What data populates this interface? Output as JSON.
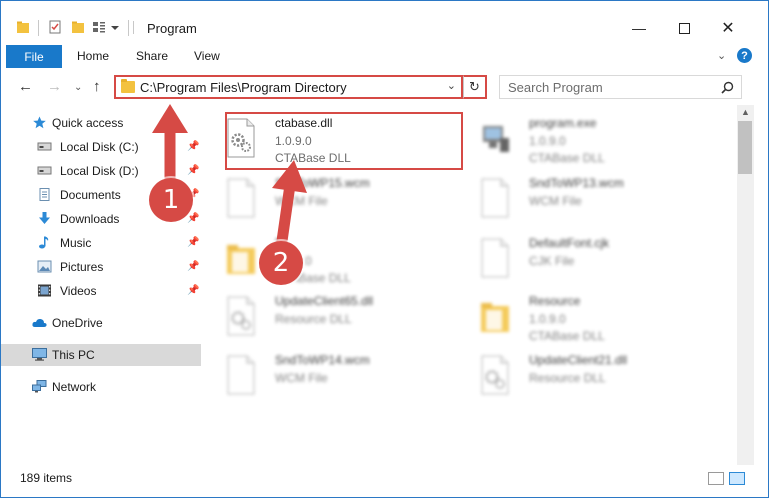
{
  "window": {
    "title": "Program"
  },
  "ribbon": {
    "tabs": [
      "File",
      "Home",
      "Share",
      "View"
    ],
    "help": "?"
  },
  "nav": {
    "back": "←",
    "forward": "→",
    "up": "↑",
    "address": "C:\\Program Files\\Program Directory",
    "refresh": "↻",
    "search_placeholder": "Search Program"
  },
  "sidebar": {
    "items": [
      {
        "label": "Quick access",
        "icon": "star-icon",
        "pinned": false
      },
      {
        "label": "Local Disk (C:)",
        "icon": "drive-icon",
        "pinned": true
      },
      {
        "label": "Local Disk (D:)",
        "icon": "drive-icon",
        "pinned": true
      },
      {
        "label": "Documents",
        "icon": "documents-icon",
        "pinned": true
      },
      {
        "label": "Downloads",
        "icon": "download-icon",
        "pinned": true
      },
      {
        "label": "Music",
        "icon": "music-icon",
        "pinned": true
      },
      {
        "label": "Pictures",
        "icon": "pictures-icon",
        "pinned": true
      },
      {
        "label": "Videos",
        "icon": "videos-icon",
        "pinned": true
      },
      {
        "label": "OneDrive",
        "icon": "cloud-icon",
        "pinned": false
      },
      {
        "label": "This PC",
        "icon": "computer-icon",
        "pinned": false,
        "selected": true
      },
      {
        "label": "Network",
        "icon": "network-icon",
        "pinned": false
      }
    ]
  },
  "files": [
    {
      "name": "ctabase.dll",
      "line1": "1.0.9.0",
      "line2": "CTABase DLL",
      "type": "dll",
      "highlighted": true
    },
    {
      "name": "program.exe",
      "line1": "1.0.9.0",
      "line2": "CTABase DLL",
      "type": "exe"
    },
    {
      "name": "SndToWP15.wcm",
      "line1": "WCM File",
      "line2": "",
      "type": "file"
    },
    {
      "name": "SndToWP13.wcm",
      "line1": "WCM File",
      "line2": "",
      "type": "file"
    },
    {
      "name": "Ri",
      "line1": "1.0.9.0",
      "line2": "CTABase DLL",
      "type": "folder"
    },
    {
      "name": "DefaultFont.cjk",
      "line1": "CJK File",
      "line2": "",
      "type": "file"
    },
    {
      "name": "UpdateClient65.dll",
      "line1": "Resource DLL",
      "line2": "",
      "type": "dll"
    },
    {
      "name": "Resource",
      "line1": "1.0.9.0",
      "line2": "CTABase DLL",
      "type": "folder"
    },
    {
      "name": "SndToWP14.wcm",
      "line1": "WCM File",
      "line2": "",
      "type": "file"
    },
    {
      "name": "UpdateClient21.dll",
      "line1": "Resource DLL",
      "line2": "",
      "type": "dll"
    }
  ],
  "status": {
    "count": "189 items"
  },
  "annotations": {
    "step1": "1",
    "step2": "2",
    "color": "#d64a45"
  },
  "colors": {
    "accent": "#1979ca",
    "highlight": "#d64a45"
  }
}
